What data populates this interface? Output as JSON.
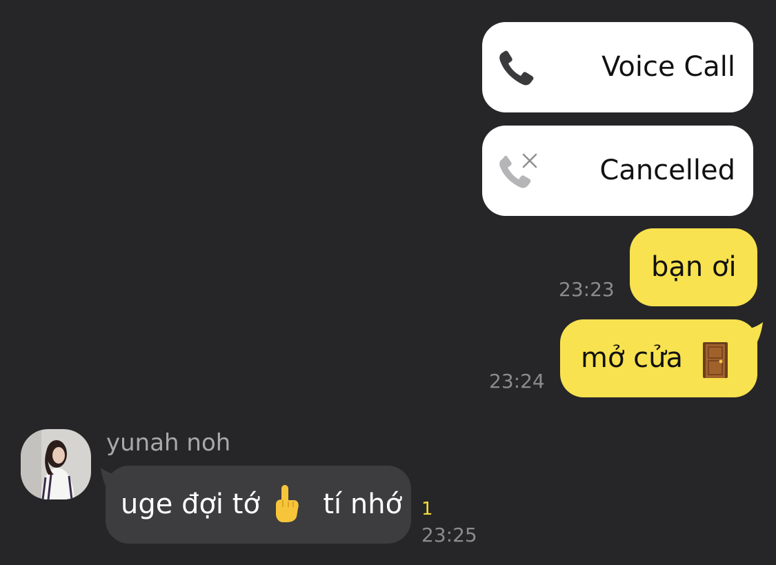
{
  "calls": [
    {
      "label": "Voice Call",
      "icon": "phone-icon"
    },
    {
      "label": "Cancelled",
      "icon": "phone-cancelled-icon"
    }
  ],
  "messages": {
    "m1": {
      "text": "bạn ơi",
      "time": "23:23"
    },
    "m2": {
      "text": "mở cửa",
      "emoji": "door-emoji",
      "time": "23:24"
    },
    "m3": {
      "sender": "yunah noh",
      "text_before": "uge đợi tớ",
      "emoji": "index-pointing-up-emoji",
      "text_after": "tí nhớ",
      "unread": "1",
      "time": "23:25"
    }
  },
  "colors": {
    "background": "#262628",
    "my_bubble": "#f8e24f",
    "their_bubble": "#3d3d3f",
    "call_card": "#ffffff",
    "unread": "#f5dc3a"
  }
}
